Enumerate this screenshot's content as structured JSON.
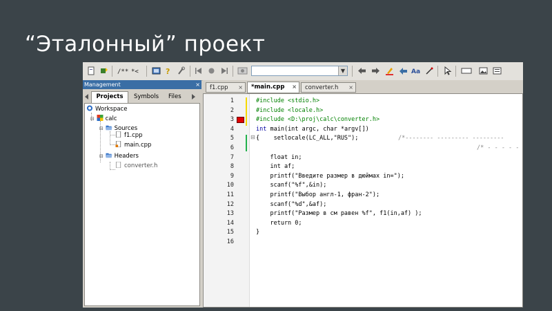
{
  "slide": {
    "title": "“Эталонный” проект"
  },
  "toolbar": {
    "search_combo_value": "",
    "icons": [
      "new-file-icon",
      "build-icon",
      "comment-icon",
      "uncomment-icon",
      "run-icon",
      "debug-icon",
      "settings-icon",
      "nav-back-icon",
      "breakpoint-icon",
      "nav-forward-icon",
      "jump-icon",
      "find-prev-icon",
      "find-next-icon",
      "highlight-icon",
      "replace-icon",
      "text-icon",
      "select-icon",
      "cursor-icon",
      "rect-icon",
      "image-icon",
      "toggle-icon"
    ]
  },
  "management": {
    "header": "Management",
    "close": "×",
    "tabs": [
      "Projects",
      "Symbols",
      "Files"
    ],
    "active_tab": "Projects",
    "tree": {
      "workspace": "Workspace",
      "project": "calc",
      "sources_folder": "Sources",
      "sources": [
        "f1.cpp",
        "main.cpp"
      ],
      "headers_folder": "Headers",
      "headers": [
        "converter.h"
      ]
    }
  },
  "editor": {
    "tabs": [
      {
        "label": "f1.cpp",
        "close": "×"
      },
      {
        "label": "*main.cpp",
        "close": "×"
      },
      {
        "label": "converter.h",
        "close": "×"
      }
    ],
    "active_tab": "*main.cpp",
    "line_numbers": [
      "1",
      "2",
      "3",
      "4",
      "5",
      "6",
      "7",
      "8",
      "9",
      "10",
      "11",
      "12",
      "13",
      "14",
      "15",
      "16"
    ],
    "fold_marker": "⊟",
    "lines": [
      {
        "kw": "",
        "text": "#include <stdio.h>"
      },
      {
        "kw": "",
        "text": "#include <locale.h>"
      },
      {
        "kw": "",
        "text": "#include <D:\\proj\\calc\\converter.h>"
      },
      {
        "kw": "int",
        "text": " main(int argc, char *argv[])"
      },
      {
        "kw": "",
        "text": "{    setlocale(LC_ALL,\"RUS\");"
      },
      {
        "kw": "",
        "text": ""
      },
      {
        "kw": "",
        "text": "    float in;"
      },
      {
        "kw": "",
        "text": "    int af;"
      },
      {
        "kw": "",
        "text": "    printf(\"Введите размер в дюймах in=\");"
      },
      {
        "kw": "",
        "text": "    scanf(\"%f\",&in);"
      },
      {
        "kw": "",
        "text": "    printf(\"Выбор англ-1, фран-2\");"
      },
      {
        "kw": "",
        "text": "    scanf(\"%d\",&af);"
      },
      {
        "kw": "",
        "text": "    printf(\"Размер в см равен %f\", f1(in,af) );"
      },
      {
        "kw": "",
        "text": "    return 0;"
      },
      {
        "kw": "",
        "text": "}"
      },
      {
        "kw": "",
        "text": ""
      }
    ],
    "comment_fragment_1": "/*-------- --------- ---------",
    "comment_fragment_2": "/* - - - - -"
  },
  "colors": {
    "slide_bg": "#3b4449",
    "management_header": "#3a6ea5",
    "breakpoint_marker": "#e00000",
    "change_marker_yellow": "#f5d800",
    "change_marker_green": "#22b14c"
  }
}
